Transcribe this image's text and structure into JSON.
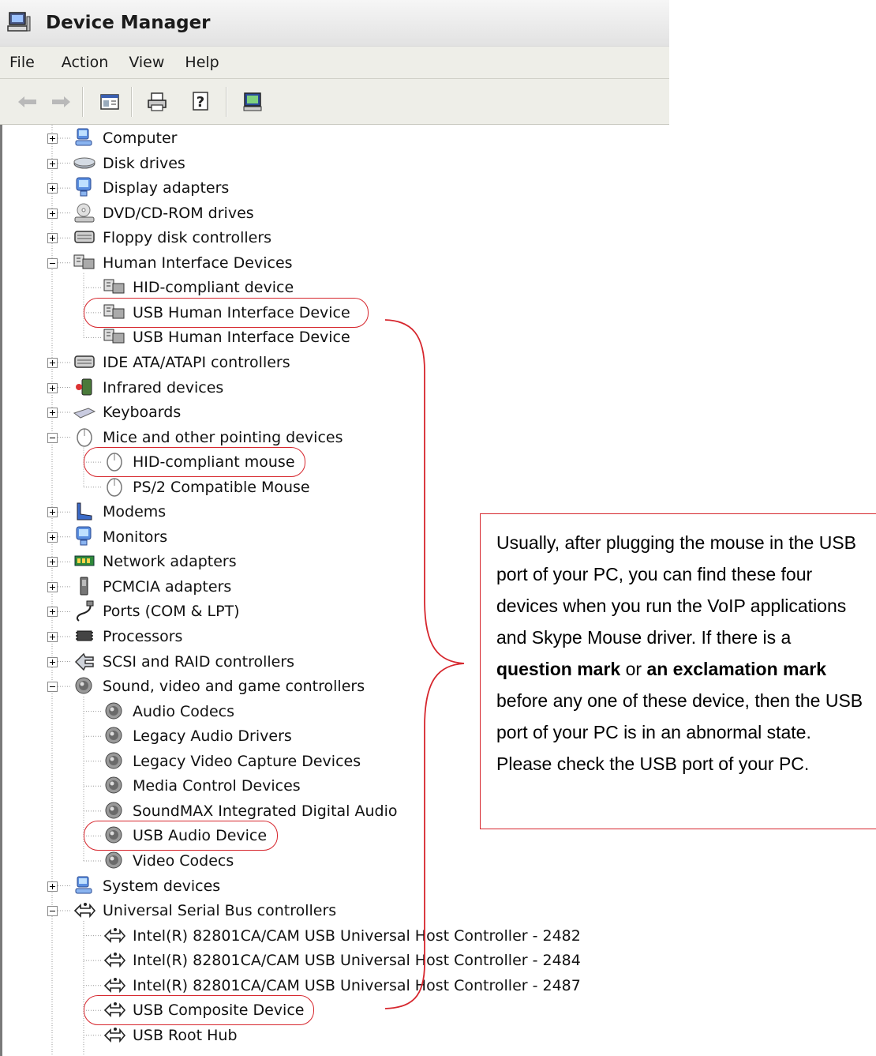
{
  "window": {
    "title": "Device Manager",
    "icon": "computer-icon"
  },
  "menu": [
    "File",
    "Action",
    "View",
    "Help"
  ],
  "toolbar": [
    {
      "name": "back-arrow-icon"
    },
    {
      "name": "forward-arrow-icon"
    },
    {
      "name": "properties-icon"
    },
    {
      "name": "print-icon"
    },
    {
      "name": "help-icon"
    },
    {
      "name": "scan-hardware-icon"
    }
  ],
  "tree": [
    {
      "label": "Computer",
      "level": 0,
      "exp": "plus",
      "icon": "computer"
    },
    {
      "label": "Disk drives",
      "level": 0,
      "exp": "plus",
      "icon": "disk"
    },
    {
      "label": "Display adapters",
      "level": 0,
      "exp": "plus",
      "icon": "monitor"
    },
    {
      "label": "DVD/CD-ROM drives",
      "level": 0,
      "exp": "plus",
      "icon": "dvd"
    },
    {
      "label": "Floppy disk controllers",
      "level": 0,
      "exp": "plus",
      "icon": "controller"
    },
    {
      "label": "Human Interface Devices",
      "level": 0,
      "exp": "minus",
      "icon": "hid"
    },
    {
      "label": "HID-compliant device",
      "level": 1,
      "icon": "hid"
    },
    {
      "label": "USB Human Interface Device",
      "level": 1,
      "icon": "hid",
      "highlight": true
    },
    {
      "label": "USB Human Interface Device",
      "level": 1,
      "icon": "hid"
    },
    {
      "label": "IDE ATA/ATAPI controllers",
      "level": 0,
      "exp": "plus",
      "icon": "controller"
    },
    {
      "label": "Infrared devices",
      "level": 0,
      "exp": "plus",
      "icon": "infrared"
    },
    {
      "label": "Keyboards",
      "level": 0,
      "exp": "plus",
      "icon": "keyboard"
    },
    {
      "label": "Mice and other pointing devices",
      "level": 0,
      "exp": "minus",
      "icon": "mouse"
    },
    {
      "label": "HID-compliant mouse",
      "level": 1,
      "icon": "mouse",
      "highlight": true
    },
    {
      "label": "PS/2 Compatible Mouse",
      "level": 1,
      "icon": "mouse"
    },
    {
      "label": "Modems",
      "level": 0,
      "exp": "plus",
      "icon": "modem"
    },
    {
      "label": "Monitors",
      "level": 0,
      "exp": "plus",
      "icon": "monitor"
    },
    {
      "label": "Network adapters",
      "level": 0,
      "exp": "plus",
      "icon": "network"
    },
    {
      "label": "PCMCIA adapters",
      "level": 0,
      "exp": "plus",
      "icon": "pcmcia"
    },
    {
      "label": "Ports (COM & LPT)",
      "level": 0,
      "exp": "plus",
      "icon": "port"
    },
    {
      "label": "Processors",
      "level": 0,
      "exp": "plus",
      "icon": "processor"
    },
    {
      "label": "SCSI and RAID controllers",
      "level": 0,
      "exp": "plus",
      "icon": "scsi"
    },
    {
      "label": "Sound, video and game controllers",
      "level": 0,
      "exp": "minus",
      "icon": "sound"
    },
    {
      "label": "Audio Codecs",
      "level": 1,
      "icon": "sound"
    },
    {
      "label": "Legacy Audio Drivers",
      "level": 1,
      "icon": "sound"
    },
    {
      "label": "Legacy Video Capture Devices",
      "level": 1,
      "icon": "sound"
    },
    {
      "label": "Media Control Devices",
      "level": 1,
      "icon": "sound"
    },
    {
      "label": "SoundMAX Integrated Digital Audio",
      "level": 1,
      "icon": "sound"
    },
    {
      "label": "USB Audio Device",
      "level": 1,
      "icon": "sound",
      "highlight": true
    },
    {
      "label": "Video Codecs",
      "level": 1,
      "icon": "sound"
    },
    {
      "label": "System devices",
      "level": 0,
      "exp": "plus",
      "icon": "computer"
    },
    {
      "label": "Universal Serial Bus controllers",
      "level": 0,
      "exp": "minus",
      "icon": "usb"
    },
    {
      "label": "Intel(R) 82801CA/CAM USB Universal Host Controller - 2482",
      "level": 1,
      "icon": "usb"
    },
    {
      "label": "Intel(R) 82801CA/CAM USB Universal Host Controller - 2484",
      "level": 1,
      "icon": "usb"
    },
    {
      "label": "Intel(R) 82801CA/CAM USB Universal Host Controller - 2487",
      "level": 1,
      "icon": "usb"
    },
    {
      "label": "USB Composite Device",
      "level": 1,
      "icon": "usb",
      "highlight": true
    },
    {
      "label": "USB Root Hub",
      "level": 1,
      "icon": "usb"
    }
  ],
  "callout": {
    "t1": "Usually, after plugging the mouse in the USB port of your PC, you can find these four devices when you run the VoIP applications and Skype Mouse driver. If there is a ",
    "b1": "question mark",
    "t2": " or ",
    "b2": "an exclamation mark",
    "t3": " before any one of these device, then the USB port of your PC is in an abnormal state. Please check the USB port of your PC."
  },
  "colors": {
    "highlight": "#d6262d",
    "chrome": "#eeeee8"
  }
}
